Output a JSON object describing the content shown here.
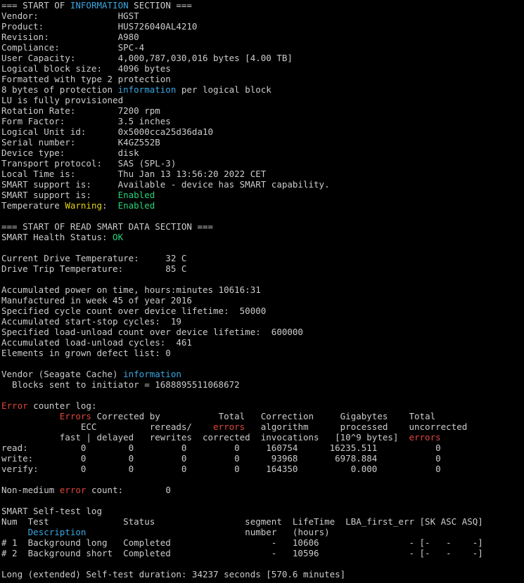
{
  "colors": {
    "background": "#000000",
    "text": "#cccccc",
    "highlight_cyan": "#3aa6e0",
    "highlight_red": "#e0463a",
    "highlight_green": "#25d37a",
    "highlight_yellow": "#e5d21a"
  },
  "lines": [
    [
      {
        "t": "=== START OF "
      },
      {
        "t": "INFORMATION",
        "c": "cyan"
      },
      {
        "t": " SECTION ==="
      }
    ],
    [
      {
        "t": "Vendor:               HGST"
      }
    ],
    [
      {
        "t": "Product:              HUS726040AL4210"
      }
    ],
    [
      {
        "t": "Revision:             A980"
      }
    ],
    [
      {
        "t": "Compliance:           SPC-4"
      }
    ],
    [
      {
        "t": "User Capacity:        4,000,787,030,016 bytes [4.00 TB]"
      }
    ],
    [
      {
        "t": "Logical block size:   4096 bytes"
      }
    ],
    [
      {
        "t": "Formatted with type 2 protection"
      }
    ],
    [
      {
        "t": "8 bytes of protection "
      },
      {
        "t": "information",
        "c": "cyan"
      },
      {
        "t": " per logical block"
      }
    ],
    [
      {
        "t": "LU is fully provisioned"
      }
    ],
    [
      {
        "t": "Rotation Rate:        7200 rpm"
      }
    ],
    [
      {
        "t": "Form Factor:          3.5 inches"
      }
    ],
    [
      {
        "t": "Logical Unit id:      0x5000cca25d36da10"
      }
    ],
    [
      {
        "t": "Serial number:        K4GZ552B"
      }
    ],
    [
      {
        "t": "Device type:          disk"
      }
    ],
    [
      {
        "t": "Transport protocol:   SAS (SPL-3)"
      }
    ],
    [
      {
        "t": "Local Time is:        Thu Jan 13 13:56:20 2022 CET"
      }
    ],
    [
      {
        "t": "SMART support is:     Available - device has SMART capability."
      }
    ],
    [
      {
        "t": "SMART support is:     "
      },
      {
        "t": "Enabled",
        "c": "green"
      }
    ],
    [
      {
        "t": "Temperature "
      },
      {
        "t": "Warning",
        "c": "yellow"
      },
      {
        "t": ":  "
      },
      {
        "t": "Enabled",
        "c": "green"
      }
    ],
    [],
    [
      {
        "t": "=== START OF READ SMART DATA SECTION ==="
      }
    ],
    [
      {
        "t": "SMART Health Status: "
      },
      {
        "t": "OK",
        "c": "green"
      }
    ],
    [],
    [
      {
        "t": "Current Drive Temperature:     32 C"
      }
    ],
    [
      {
        "t": "Drive Trip Temperature:        85 C"
      }
    ],
    [],
    [
      {
        "t": "Accumulated power on time, hours:minutes 10616:31"
      }
    ],
    [
      {
        "t": "Manufactured in week 45 of year 2016"
      }
    ],
    [
      {
        "t": "Specified cycle count over device lifetime:  50000"
      }
    ],
    [
      {
        "t": "Accumulated start-stop cycles:  19"
      }
    ],
    [
      {
        "t": "Specified load-unload count over device lifetime:  600000"
      }
    ],
    [
      {
        "t": "Accumulated load-unload cycles:  461"
      }
    ],
    [
      {
        "t": "Elements in grown defect list: 0"
      }
    ],
    [],
    [
      {
        "t": "Vendor (Seagate Cache) "
      },
      {
        "t": "information",
        "c": "cyan"
      }
    ],
    [
      {
        "t": "  Blocks sent to initiator = 1688895511068672"
      }
    ],
    [],
    [
      {
        "t": "Error",
        "c": "red"
      },
      {
        "t": " counter log:"
      }
    ],
    [
      {
        "t": "           "
      },
      {
        "t": "Errors",
        "c": "red"
      },
      {
        "t": " Corrected by           Total   Correction     Gigabytes    Total"
      }
    ],
    [
      {
        "t": "               ECC          rereads/    "
      },
      {
        "t": "errors",
        "c": "red"
      },
      {
        "t": "   algorithm      processed    uncorrected"
      }
    ],
    [
      {
        "t": "           fast | delayed   rewrites  corrected  invocations   [10^9 bytes]  "
      },
      {
        "t": "errors",
        "c": "red"
      }
    ],
    [
      {
        "t": "read:          0        0         0         0     160754      16235.511           0"
      }
    ],
    [
      {
        "t": "write:         0        0         0         0      93968       6978.884           0"
      }
    ],
    [
      {
        "t": "verify:        0        0         0         0     164350          0.000           0"
      }
    ],
    [],
    [
      {
        "t": "Non-medium "
      },
      {
        "t": "error",
        "c": "red"
      },
      {
        "t": " count:        0"
      }
    ],
    [],
    [
      {
        "t": "SMART Self-test log"
      }
    ],
    [
      {
        "t": "Num  Test              Status                 segment  LifeTime  LBA_first_err [SK ASC ASQ]"
      }
    ],
    [
      {
        "t": "     "
      },
      {
        "t": "Description",
        "c": "cyan"
      },
      {
        "t": "                              number   (hours)"
      }
    ],
    [
      {
        "t": "# 1  Background long   Completed                   -   10606                 - [-   -    -]"
      }
    ],
    [
      {
        "t": "# 2  Background short  Completed                   -   10596                 - [-   -    -]"
      }
    ],
    [],
    [
      {
        "t": "Long (extended) Self-test duration: 34237 seconds [570.6 minutes]"
      }
    ]
  ]
}
